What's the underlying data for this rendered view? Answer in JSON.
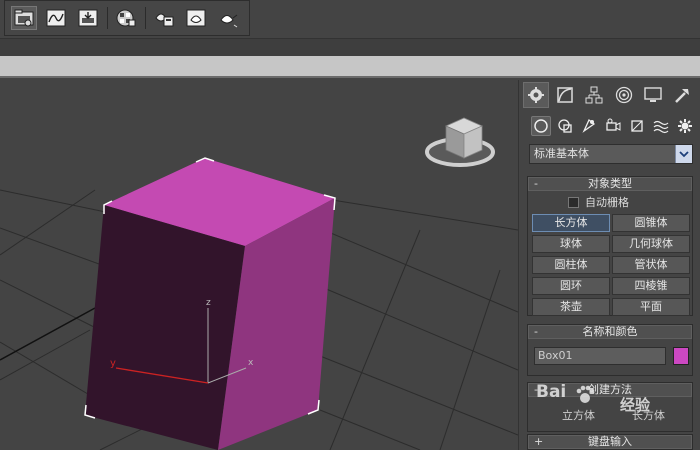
{
  "command_panel": {
    "dropdown": {
      "value": "标准基本体"
    },
    "object_type": {
      "title": "对象类型",
      "collapse_sign": "-",
      "autogrid_label": "自动栅格",
      "buttons": [
        "长方体",
        "圆锥体",
        "球体",
        "几何球体",
        "圆柱体",
        "管状体",
        "圆环",
        "四棱锥",
        "茶壶",
        "平面"
      ],
      "active": "长方体"
    },
    "name_color": {
      "title": "名称和颜色",
      "collapse_sign": "-",
      "name_value": "Box01",
      "color": "#cc48c2"
    },
    "creation_method": {
      "title": "创建方法",
      "collapse_sign": "-",
      "opt1": "立方体",
      "opt2": "长方体"
    },
    "keyboard_input": {
      "title": "键盘输入",
      "collapse_sign": "+"
    }
  },
  "viewport": {
    "axis_labels": {
      "x": "x",
      "y": "y",
      "z": "z"
    },
    "box_color_top": "#c44ab2",
    "box_color_front": "#32142b",
    "box_color_side": "#8f357f"
  },
  "watermark": {
    "brand": "Bai",
    "suffix": "经验"
  },
  "icons": {
    "toolbar": [
      "open-scene-icon",
      "track-view-icon",
      "save-render-icon",
      "material-editor-icon",
      "render-setup-icon",
      "render-frame-icon",
      "render-teapot-icon"
    ],
    "tabs": [
      "create-tab-icon",
      "modify-tab-icon",
      "hierarchy-tab-icon",
      "motion-tab-icon",
      "display-tab-icon",
      "utilities-tab-icon"
    ],
    "subcategories": [
      "geometry-icon",
      "shapes-icon",
      "lights-icon",
      "cameras-icon",
      "helpers-icon",
      "spacewarps-icon",
      "systems-icon"
    ]
  }
}
